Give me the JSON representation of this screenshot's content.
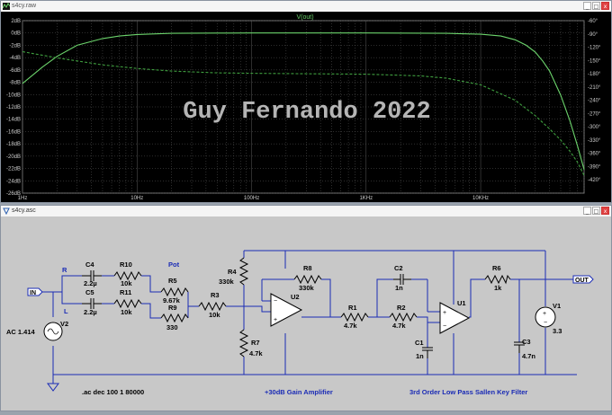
{
  "plot_window": {
    "title": "s4cy.raw",
    "trace_label": "V(out)",
    "watermark": "Guy Fernando 2022",
    "buttons": [
      "_",
      "□",
      "x"
    ]
  },
  "schematic_window": {
    "title": "s4cy.asc",
    "buttons": [
      "_",
      "□",
      "x"
    ],
    "labels": {
      "in": "IN",
      "out": "OUT",
      "R": "R",
      "L": "L",
      "pot": "Pot",
      "v2": "V2",
      "v2_value": "AC 1.414",
      "c4": "C4",
      "c4_val": "2.2µ",
      "c5": "C5",
      "c5_val": "2.2µ",
      "r10": "R10",
      "r10_val": "10k",
      "r11": "R11",
      "r11_val": "10k",
      "r5": "R5",
      "r5_val": "9.67k",
      "r9": "R9",
      "r9_val": "330",
      "r3": "R3",
      "r3_val": "10k",
      "r4": "R4",
      "r4_val": "330k",
      "r7": "R7",
      "r7_val": "4.7k",
      "r8": "R8",
      "r8_val": "330k",
      "u2": "U2",
      "r1": "R1",
      "r1_val": "4.7k",
      "r2": "R2",
      "r2_val": "4.7k",
      "c2": "C2",
      "c2_val": "1n",
      "c1": "C1",
      "c1_val": "1n",
      "u1": "U1",
      "r6": "R6",
      "r6_val": "1k",
      "c3": "C3",
      "c3_val": "4.7n",
      "v1": "V1",
      "v1_val": "3.3",
      "directive": ".ac dec 100 1 80000",
      "amp_label": "+30dB Gain Amplifier",
      "filter_label": "3rd Order Low Pass Sallen Key Filter"
    }
  },
  "chart_data": {
    "type": "line",
    "title": "V(out)",
    "x_scale": "log",
    "xlim": [
      1,
      80000
    ],
    "x_ticks": [
      "1Hz",
      "10Hz",
      "100Hz",
      "1KHz",
      "10KHz"
    ],
    "left_axis_ticks": [
      "2dB",
      "0dB",
      "-2dB",
      "-4dB",
      "-6dB",
      "-8dB",
      "-10dB",
      "-12dB",
      "-14dB",
      "-16dB",
      "-18dB",
      "-20dB",
      "-22dB",
      "-24dB",
      "-26dB"
    ],
    "ylim": [
      -26,
      2
    ],
    "right_axis_ticks": [
      "-60°",
      "-90°",
      "-120°",
      "-150°",
      "-180°",
      "-210°",
      "-240°",
      "-270°",
      "-300°",
      "-330°",
      "-360°",
      "-390°",
      "-420°"
    ],
    "y2lim": [
      -450,
      -60
    ],
    "grid": true,
    "colors": {
      "magnitude": "#6cd46c",
      "phase": "#3f9e3f",
      "grid": "#5b5b5b",
      "background": "#000000"
    },
    "series": [
      {
        "name": "V(out)",
        "axis": "left",
        "style": "solid",
        "x": [
          1,
          1.5,
          2,
          3,
          5,
          7,
          10,
          20,
          50,
          100,
          1000,
          5000,
          10000,
          15000,
          20000,
          25000,
          30000,
          35000,
          40000,
          50000,
          60000,
          70000,
          80000
        ],
        "values": [
          -8.2,
          -5.5,
          -3.8,
          -2.0,
          -0.9,
          -0.5,
          -0.25,
          -0.06,
          -0.01,
          0,
          0,
          -0.05,
          -0.2,
          -0.5,
          -1.1,
          -2.0,
          -3.1,
          -4.6,
          -6.2,
          -10.1,
          -14.2,
          -18.3,
          -22.2
        ]
      },
      {
        "name": "",
        "axis": "right",
        "style": "dashed",
        "x": [
          1,
          2,
          5,
          10,
          20,
          50,
          100,
          300,
          1000,
          3000,
          5000,
          10000,
          20000,
          30000,
          40000,
          50000,
          60000,
          70000,
          80000
        ],
        "values": [
          -130,
          -144,
          -160,
          -168,
          -174,
          -178,
          -179,
          -180,
          -181,
          -185,
          -190,
          -205,
          -240,
          -275,
          -305,
          -330,
          -355,
          -380,
          -410
        ]
      }
    ]
  }
}
